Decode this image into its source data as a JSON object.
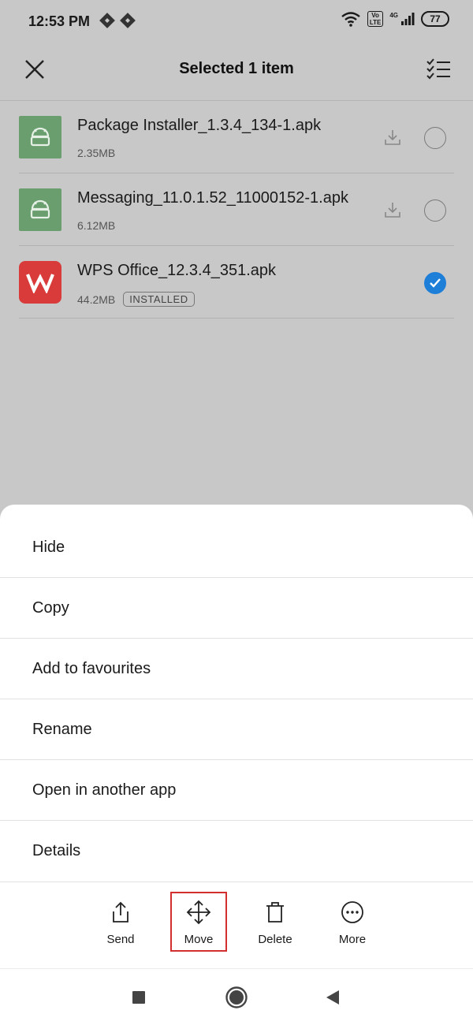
{
  "status_bar": {
    "time": "12:53 PM",
    "volte": "Vo\nLTE",
    "network": "4G",
    "battery": "77"
  },
  "header": {
    "title": "Selected 1 item",
    "close_icon": "close-icon",
    "select_all_icon": "checklist-icon"
  },
  "files": [
    {
      "name": "Package Installer_1.3.4_134-1.apk",
      "size": "2.35MB",
      "icon": "android-icon",
      "badge": "",
      "selected": false
    },
    {
      "name": "Messaging_11.0.1.52_11000152-1.apk",
      "size": "6.12MB",
      "icon": "android-icon",
      "badge": "",
      "selected": false
    },
    {
      "name": "WPS Office_12.3.4_351.apk",
      "size": "44.2MB",
      "icon": "wps-office-icon",
      "badge": "INSTALLED",
      "selected": true
    }
  ],
  "menu": {
    "items": [
      "Hide",
      "Copy",
      "Add to favourites",
      "Rename",
      "Open in another app",
      "Details"
    ]
  },
  "actions": {
    "send": "Send",
    "move": "Move",
    "delete": "Delete",
    "more": "More"
  },
  "colors": {
    "accent": "#1e7fd8",
    "highlight": "#d32f2f",
    "apk_icon_bg": "#6a9e6e",
    "wps_icon_bg": "#d93a3a",
    "dim_overlay": "#c8c8c8"
  }
}
